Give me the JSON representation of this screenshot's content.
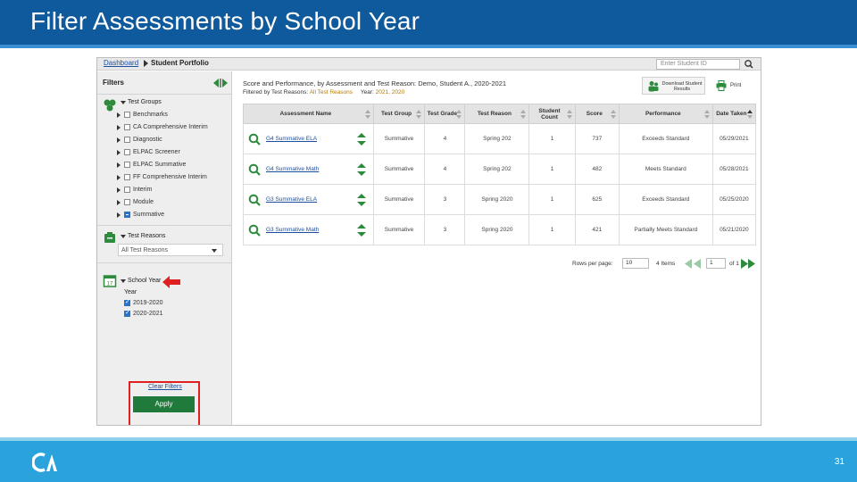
{
  "slide": {
    "title": "Filter Assessments by School Year",
    "page_number": "31"
  },
  "app": {
    "breadcrumb_link": "Dashboard",
    "breadcrumb_current": "Student Portfolio",
    "search_placeholder": "Enter Student ID"
  },
  "filters": {
    "title": "Filters",
    "test_groups": {
      "title": "Test Groups",
      "items": [
        {
          "label": "Benchmarks"
        },
        {
          "label": "CA Comprehensive Interim"
        },
        {
          "label": "Diagnostic"
        },
        {
          "label": "ELPAC Screener"
        },
        {
          "label": "ELPAC Summative"
        },
        {
          "label": "FF Comprehensive Interim"
        },
        {
          "label": "Interim"
        },
        {
          "label": "Module"
        },
        {
          "label": "Summative"
        }
      ]
    },
    "test_reasons": {
      "title": "Test Reasons",
      "selected": "All Test Reasons"
    },
    "school_year": {
      "title": "School Year",
      "subheading": "Year",
      "items": [
        {
          "label": "2019-2020",
          "checked": true
        },
        {
          "label": "2020-2021",
          "checked": true
        }
      ]
    },
    "clear_label": "Clear Filters",
    "apply_label": "Apply"
  },
  "main": {
    "title": "Score and Performance, by Assessment and Test Reason: Demo, Student A., 2020-2021",
    "filtered_prefix": "Filtered by Test Reasons:",
    "filtered_value": "All Test Reasons",
    "year_prefix": "Year:",
    "year_value": "2021, 2020",
    "download_label": "Download Student Results",
    "print_label": "Print",
    "columns": [
      "Assessment Name",
      "Test Group",
      "Test Grade",
      "Test Reason",
      "Student Count",
      "Score",
      "Performance",
      "Date Taken"
    ],
    "rows": [
      {
        "name": "G4 Summative ELA",
        "group": "Summative",
        "grade": "4",
        "reason": "Spring 202",
        "count": "1",
        "score": "737",
        "performance": "Exceeds Standard",
        "date": "05/29/2021"
      },
      {
        "name": "G4 Summative Math",
        "group": "Summative",
        "grade": "4",
        "reason": "Spring 202",
        "count": "1",
        "score": "482",
        "performance": "Meets Standard",
        "date": "05/28/2021"
      },
      {
        "name": "G3 Summative ELA",
        "group": "Summative",
        "grade": "3",
        "reason": "Spring 2020",
        "count": "1",
        "score": "625",
        "performance": "Exceeds Standard",
        "date": "05/25/2020"
      },
      {
        "name": "G3 Summative Math",
        "group": "Summative",
        "grade": "3",
        "reason": "Spring 2020",
        "count": "1",
        "score": "421",
        "performance": "Partially Meets Standard",
        "date": "05/21/2020"
      }
    ],
    "pager": {
      "rows_label": "Rows per page:",
      "rows_value": "10",
      "items_label": "4 Items",
      "page_value": "1",
      "of_label": "of 1"
    }
  },
  "colors": {
    "header": "#0f5a9c",
    "footer": "#2aa3dd",
    "apply": "#1f7a3c",
    "highlight": "#e02020",
    "icon_green": "#2e8b3e"
  }
}
